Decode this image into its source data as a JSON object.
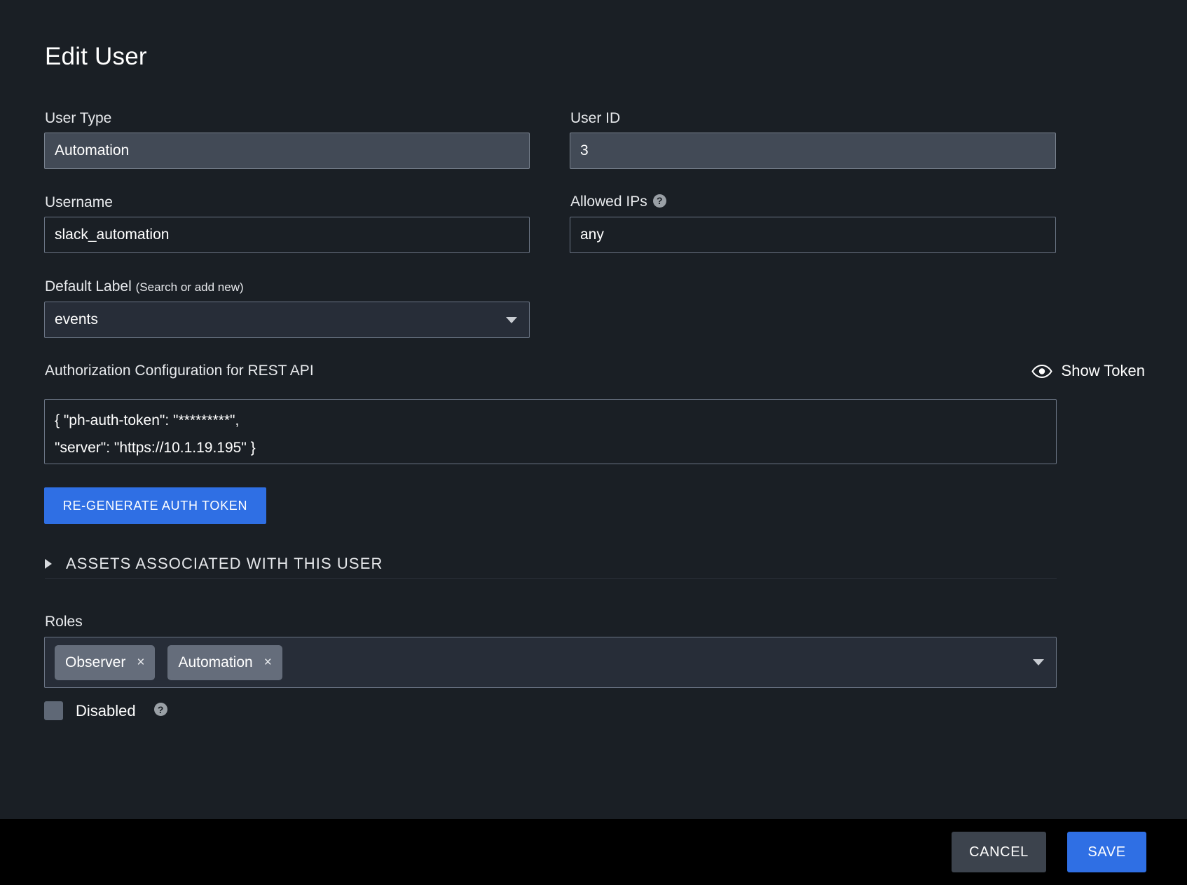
{
  "dialog": {
    "title": "Edit User"
  },
  "fields": {
    "user_type": {
      "label": "User Type",
      "value": "Automation"
    },
    "user_id": {
      "label": "User ID",
      "value": "3"
    },
    "username": {
      "label": "Username",
      "value": "slack_automation"
    },
    "allowed_ips": {
      "label": "Allowed IPs",
      "value": "any",
      "help_glyph": "?"
    },
    "default_label": {
      "label": "Default Label",
      "hint": "(Search or add new)",
      "value": "events"
    }
  },
  "auth_section": {
    "title": "Authorization Configuration for REST API",
    "show_token_label": "Show Token",
    "show_token_icon": "eye-icon",
    "token_line_1": "{ \"ph-auth-token\": \"*********\",",
    "token_line_2": "\"server\": \"https://10.1.19.195\" }",
    "regenerate_label": "RE-GENERATE AUTH TOKEN"
  },
  "assets_section": {
    "label": "ASSETS ASSOCIATED WITH THIS USER",
    "expand_icon": "triangle-right-icon",
    "expanded": false
  },
  "roles_section": {
    "label": "Roles",
    "chips": [
      {
        "label": "Observer",
        "remove_glyph": "×"
      },
      {
        "label": "Automation",
        "remove_glyph": "×"
      }
    ],
    "dropdown_icon": "chevron-down-icon"
  },
  "disabled_row": {
    "label": "Disabled",
    "checked": false,
    "help_glyph": "?"
  },
  "footer": {
    "cancel_label": "CANCEL",
    "save_label": "SAVE"
  },
  "colors": {
    "panel_bg": "#1a1f25",
    "footer_bg": "#000000",
    "accent_blue": "#2f6fe4",
    "field_filled": "#424a56",
    "select_bg": "#272d38",
    "chip_bg": "#656d7b",
    "border": "#6b7585"
  }
}
